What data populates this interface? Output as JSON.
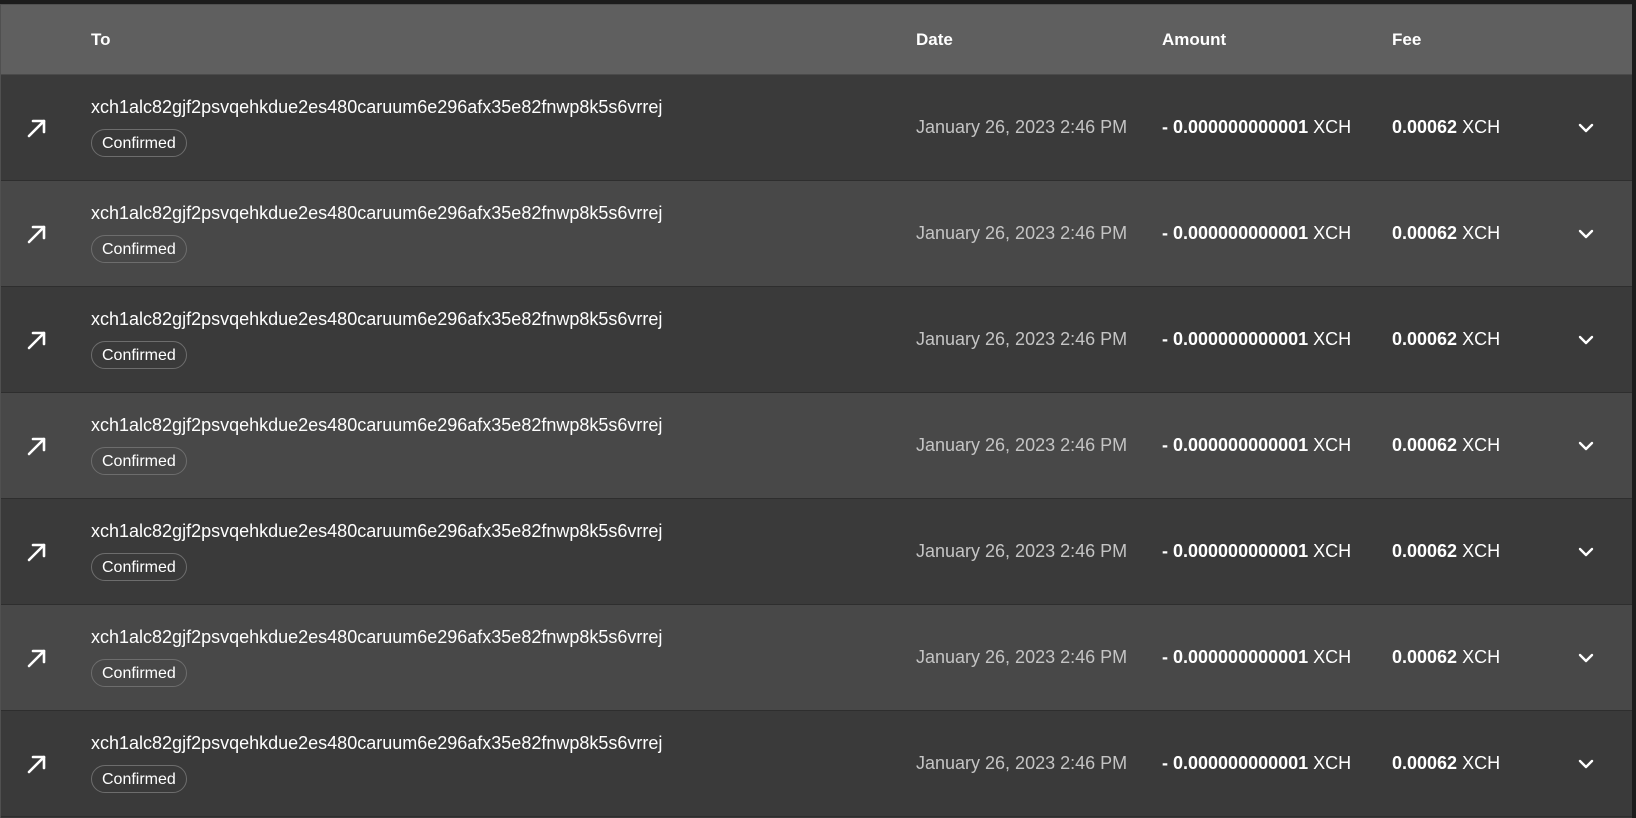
{
  "table": {
    "headers": {
      "to": "To",
      "date": "Date",
      "amount": "Amount",
      "fee": "Fee"
    },
    "rows": [
      {
        "direction_icon": "arrow-up-right-icon",
        "address": "xch1alc82gjf2psvqehkdue2es480caruum6e296afx35e82fnwp8k5s6vrrej",
        "status": "Confirmed",
        "date": "January 26, 2023 2:46 PM",
        "amount_sign": "- ",
        "amount_value": "0.000000000001",
        "amount_unit": " XCH",
        "fee_value": "0.00062",
        "fee_unit": " XCH",
        "expand_icon": "chevron-down-icon"
      },
      {
        "direction_icon": "arrow-up-right-icon",
        "address": "xch1alc82gjf2psvqehkdue2es480caruum6e296afx35e82fnwp8k5s6vrrej",
        "status": "Confirmed",
        "date": "January 26, 2023 2:46 PM",
        "amount_sign": "- ",
        "amount_value": "0.000000000001",
        "amount_unit": " XCH",
        "fee_value": "0.00062",
        "fee_unit": " XCH",
        "expand_icon": "chevron-down-icon"
      },
      {
        "direction_icon": "arrow-up-right-icon",
        "address": "xch1alc82gjf2psvqehkdue2es480caruum6e296afx35e82fnwp8k5s6vrrej",
        "status": "Confirmed",
        "date": "January 26, 2023 2:46 PM",
        "amount_sign": "- ",
        "amount_value": "0.000000000001",
        "amount_unit": " XCH",
        "fee_value": "0.00062",
        "fee_unit": " XCH",
        "expand_icon": "chevron-down-icon"
      },
      {
        "direction_icon": "arrow-up-right-icon",
        "address": "xch1alc82gjf2psvqehkdue2es480caruum6e296afx35e82fnwp8k5s6vrrej",
        "status": "Confirmed",
        "date": "January 26, 2023 2:46 PM",
        "amount_sign": "- ",
        "amount_value": "0.000000000001",
        "amount_unit": " XCH",
        "fee_value": "0.00062",
        "fee_unit": " XCH",
        "expand_icon": "chevron-down-icon"
      },
      {
        "direction_icon": "arrow-up-right-icon",
        "address": "xch1alc82gjf2psvqehkdue2es480caruum6e296afx35e82fnwp8k5s6vrrej",
        "status": "Confirmed",
        "date": "January 26, 2023 2:46 PM",
        "amount_sign": "- ",
        "amount_value": "0.000000000001",
        "amount_unit": " XCH",
        "fee_value": "0.00062",
        "fee_unit": " XCH",
        "expand_icon": "chevron-down-icon"
      },
      {
        "direction_icon": "arrow-up-right-icon",
        "address": "xch1alc82gjf2psvqehkdue2es480caruum6e296afx35e82fnwp8k5s6vrrej",
        "status": "Confirmed",
        "date": "January 26, 2023 2:46 PM",
        "amount_sign": "- ",
        "amount_value": "0.000000000001",
        "amount_unit": " XCH",
        "fee_value": "0.00062",
        "fee_unit": " XCH",
        "expand_icon": "chevron-down-icon"
      },
      {
        "direction_icon": "arrow-up-right-icon",
        "address": "xch1alc82gjf2psvqehkdue2es480caruum6e296afx35e82fnwp8k5s6vrrej",
        "status": "Confirmed",
        "date": "January 26, 2023 2:46 PM",
        "amount_sign": "- ",
        "amount_value": "0.000000000001",
        "amount_unit": " XCH",
        "fee_value": "0.00062",
        "fee_unit": " XCH",
        "expand_icon": "chevron-down-icon"
      }
    ]
  },
  "colors": {
    "header_bg": "#5f5f5f",
    "row_odd_bg": "#3a3a3a",
    "row_even_bg": "#484848",
    "date_text": "#c4c4c4",
    "badge_border": "#6d6d6d"
  }
}
